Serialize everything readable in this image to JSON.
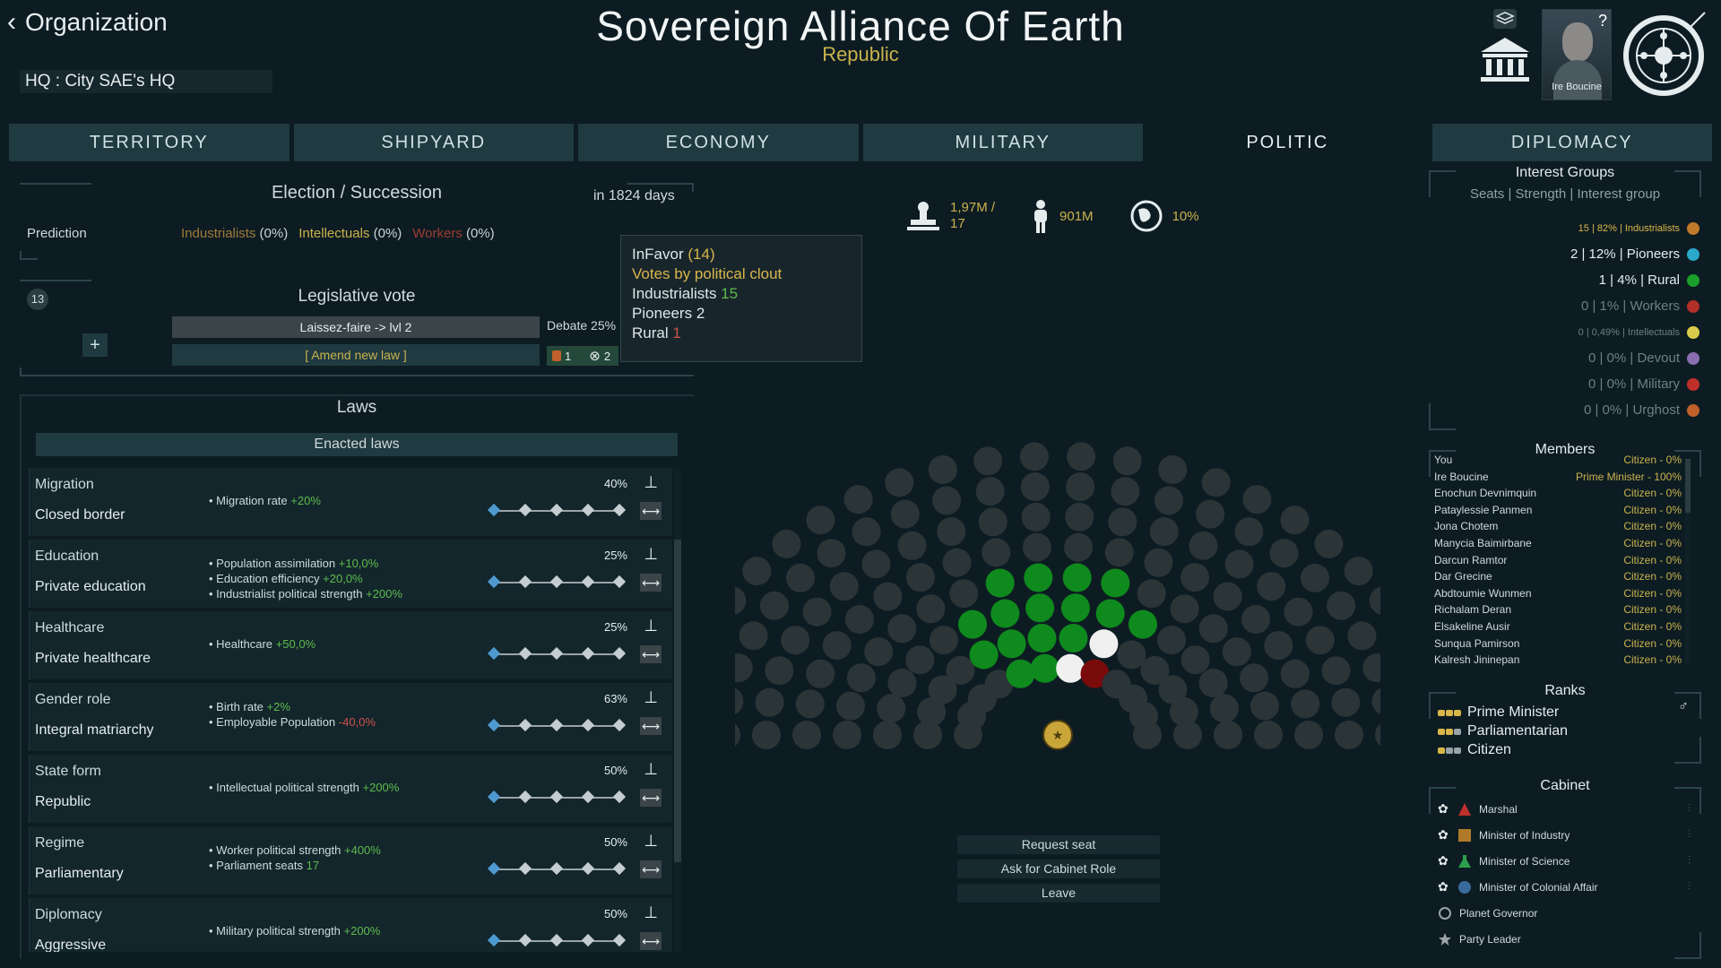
{
  "header": {
    "back_label": "Organization",
    "hq_label": "HQ : City SAE's HQ",
    "title": "Sovereign Alliance Of Earth",
    "subtitle": "Republic",
    "portrait_name": "Ire Boucine"
  },
  "tabs": [
    "TERRITORY",
    "SHIPYARD",
    "ECONOMY",
    "MILITARY",
    "POLITIC",
    "DIPLOMACY"
  ],
  "active_tab": "POLITIC",
  "election": {
    "title": "Election / Succession",
    "days": "in 1824 days",
    "prediction_label": "Prediction",
    "prediction": [
      {
        "name": "Industrialists",
        "pct": " (0%)",
        "color": "#a07a3a"
      },
      {
        "name": "Intellectuals",
        "pct": " (0%)",
        "color": "#c9b24d"
      },
      {
        "name": "Workers",
        "pct": " (0%)",
        "color": "#9e3b33"
      }
    ]
  },
  "legislative": {
    "title": "Legislative vote",
    "turn": "13",
    "add_label": "+",
    "vote_law": "Laissez-faire -> lvl 2",
    "amend_label": "[ Amend new law ]",
    "debate": "Debate 25%",
    "against": "1",
    "abstain": "2"
  },
  "tooltip": {
    "infavor_label": "InFavor",
    "infavor_count": "(14)",
    "votes_title": "Votes by political clout",
    "lines": [
      {
        "name": "Industrialists",
        "value": "15",
        "color": "green"
      },
      {
        "name": "Pioneers",
        "value": "2",
        "color": ""
      },
      {
        "name": "Rural",
        "value": "1",
        "color": "red"
      }
    ]
  },
  "laws": {
    "title": "Laws",
    "enacted_label": "Enacted laws",
    "items": [
      {
        "category": "Migration",
        "name": "Closed border",
        "pct": "40%",
        "level": 0,
        "effects": [
          {
            "text": "Migration rate ",
            "value": "+20%",
            "cls": "pos"
          }
        ]
      },
      {
        "category": "Education",
        "name": "Private education",
        "pct": "25%",
        "level": 0,
        "effects": [
          {
            "text": "Population assimilation ",
            "value": "+10,0%",
            "cls": "pos"
          },
          {
            "text": "Education efficiency ",
            "value": "+20,0%",
            "cls": "pos"
          },
          {
            "text": "Industrialist political strength ",
            "value": "+200%",
            "cls": "pos"
          }
        ]
      },
      {
        "category": "Healthcare",
        "name": "Private healthcare",
        "pct": "25%",
        "level": 0,
        "effects": [
          {
            "text": "Healthcare ",
            "value": "+50,0%",
            "cls": "pos"
          }
        ]
      },
      {
        "category": "Gender role",
        "name": "Integral matriarchy",
        "pct": "63%",
        "level": 0,
        "effects": [
          {
            "text": "Birth rate ",
            "value": "+2%",
            "cls": "pos"
          },
          {
            "text": "Employable Population ",
            "value": "-40,0%",
            "cls": "neg"
          }
        ]
      },
      {
        "category": "State form",
        "name": "Republic",
        "pct": "50%",
        "level": 0,
        "effects": [
          {
            "text": "Intellectual political strength ",
            "value": "+200%",
            "cls": "pos"
          }
        ]
      },
      {
        "category": "Regime",
        "name": "Parliamentary",
        "pct": "50%",
        "level": 0,
        "effects": [
          {
            "text": "Worker political strength ",
            "value": "+400%",
            "cls": "pos"
          },
          {
            "text": "Parliament seats ",
            "value": "17",
            "cls": "pos"
          }
        ]
      },
      {
        "category": "Diplomacy",
        "name": "Aggressive",
        "pct": "50%",
        "level": 0,
        "effects": [
          {
            "text": "Military political strength ",
            "value": "+200%",
            "cls": "pos"
          }
        ]
      }
    ]
  },
  "stats": {
    "votes": "1,97M /",
    "votes_sub": "17",
    "population": "901M",
    "share": "10%"
  },
  "parliament": {
    "rows": [
      {
        "n": 12,
        "colors": [
          "#2b3538",
          "#2b3538",
          "#2b3538",
          "#2b3538",
          "#0f8a1d",
          "#0f8a1d",
          "#f0f0f0",
          "#7a0b0b",
          "#2b3538",
          "#2b3538",
          "#2b3538",
          "#2b3538"
        ]
      },
      {
        "n": 14,
        "colors": [
          "#2b3538",
          "#2b3538",
          "#2b3538",
          "#2b3538",
          "#0f8a1d",
          "#0f8a1d",
          "#0f8a1d",
          "#0f8a1d",
          "#f0f0f0",
          "#2b3538",
          "#2b3538",
          "#2b3538",
          "#2b3538",
          "#2b3538"
        ]
      },
      {
        "n": 16,
        "colors": [
          "#2b3538",
          "#2b3538",
          "#2b3538",
          "#2b3538",
          "#2b3538",
          "#0f8a1d",
          "#0f8a1d",
          "#0f8a1d",
          "#0f8a1d",
          "#0f8a1d",
          "#0f8a1d",
          "#2b3538",
          "#2b3538",
          "#2b3538",
          "#2b3538",
          "#2b3538"
        ]
      },
      {
        "n": 18,
        "colors": [
          "#2b3538",
          "#2b3538",
          "#2b3538",
          "#2b3538",
          "#2b3538",
          "#2b3538",
          "#2b3538",
          "#0f8a1d",
          "#0f8a1d",
          "#0f8a1d",
          "#0f8a1d",
          "#2b3538",
          "#2b3538",
          "#2b3538",
          "#2b3538",
          "#2b3538",
          "#2b3538",
          "#2b3538"
        ]
      },
      {
        "n": 20,
        "colors": [
          "#2b3538",
          "#2b3538",
          "#2b3538",
          "#2b3538",
          "#2b3538",
          "#2b3538",
          "#2b3538",
          "#2b3538",
          "#2b3538",
          "#2b3538",
          "#2b3538",
          "#2b3538",
          "#2b3538",
          "#2b3538",
          "#2b3538",
          "#2b3538",
          "#2b3538",
          "#2b3538",
          "#2b3538",
          "#2b3538"
        ]
      },
      {
        "n": 22,
        "colors": []
      },
      {
        "n": 24,
        "colors": []
      },
      {
        "n": 26,
        "colors": []
      }
    ],
    "leader_color": "#c9a53a"
  },
  "actions": [
    "Request seat",
    "Ask for Cabinet Role",
    "Leave"
  ],
  "interest_groups": {
    "title": "Interest Groups",
    "header": "Seats | Strength | Interest group",
    "items": [
      {
        "text": "15 | 82% | Industrialists",
        "color": "#c07a2a",
        "text_color": "#d9b64a",
        "size": 11
      },
      {
        "text": "2 | 12% | Pioneers",
        "color": "#2aa8c9",
        "text_color": "#e5ecee",
        "size": 15
      },
      {
        "text": "1 | 4% | Rural",
        "color": "#1aa02a",
        "text_color": "#e5ecee",
        "size": 15
      },
      {
        "text": "0 | 1% | Workers",
        "color": "#b3302a",
        "text_color": "#6f7f84",
        "size": 15
      },
      {
        "text": "0 | 0,49% | Intellectuals",
        "color": "#d9cc4a",
        "text_color": "#6f7f84",
        "size": 11
      },
      {
        "text": "0 | 0% | Devout",
        "color": "#8a6fb0",
        "text_color": "#6f7f84",
        "size": 15
      },
      {
        "text": "0 | 0% | Military",
        "color": "#c0302a",
        "text_color": "#6f7f84",
        "size": 15
      },
      {
        "text": "0 | 0% | Urghost",
        "color": "#c0602a",
        "text_color": "#6f7f84",
        "size": 15
      }
    ]
  },
  "members": {
    "title": "Members",
    "items": [
      {
        "name": "You",
        "role": "Citizen - 0%"
      },
      {
        "name": "Ire Boucine",
        "role": "Prime Minister - 100%"
      },
      {
        "name": "Enochun Devnimquin",
        "role": "Citizen - 0%"
      },
      {
        "name": "Pataylessie Panmen",
        "role": "Citizen - 0%"
      },
      {
        "name": "Jona Chotem",
        "role": "Citizen - 0%"
      },
      {
        "name": "Manycia Baimirbane",
        "role": "Citizen - 0%"
      },
      {
        "name": "Darcun Ramtor",
        "role": "Citizen - 0%"
      },
      {
        "name": "Dar Grecine",
        "role": "Citizen - 0%"
      },
      {
        "name": "Abdtoumie Wunmen",
        "role": "Citizen - 0%"
      },
      {
        "name": "Richalam Deran",
        "role": "Citizen - 0%"
      },
      {
        "name": "Elsakeline Ausir",
        "role": "Citizen - 0%"
      },
      {
        "name": "Sunqua Pamirson",
        "role": "Citizen - 0%"
      },
      {
        "name": "Kalresh Jininepan",
        "role": "Citizen - 0%"
      }
    ]
  },
  "ranks": {
    "title": "Ranks",
    "gender_icon": "♂",
    "items": [
      {
        "label": "Prime Minister",
        "pips": [
          "#d9b64a",
          "#d9b64a",
          "#d9b64a"
        ]
      },
      {
        "label": "Parliamentarian",
        "pips": [
          "#d9b64a",
          "#d9b64a",
          "#9aa4a7"
        ]
      },
      {
        "label": "Citizen",
        "pips": [
          "#d9b64a",
          "#9aa4a7",
          "#9aa4a7"
        ]
      }
    ]
  },
  "cabinet": {
    "title": "Cabinet",
    "items": [
      {
        "label": "Marshal",
        "color": "#c0302a",
        "shape": "triangle"
      },
      {
        "label": "Minister of Industry",
        "color": "#b07a2a",
        "shape": "square"
      },
      {
        "label": "Minister of Science",
        "color": "#2aa04a",
        "shape": "flask"
      },
      {
        "label": "Minister of Colonial Affair",
        "color": "#3a6a9a",
        "shape": "circle"
      },
      {
        "label": "Planet Governor",
        "color": "#9aa4a7",
        "shape": "ring"
      },
      {
        "label": "Party Leader",
        "color": "#9aa4a7",
        "shape": "star"
      }
    ]
  }
}
